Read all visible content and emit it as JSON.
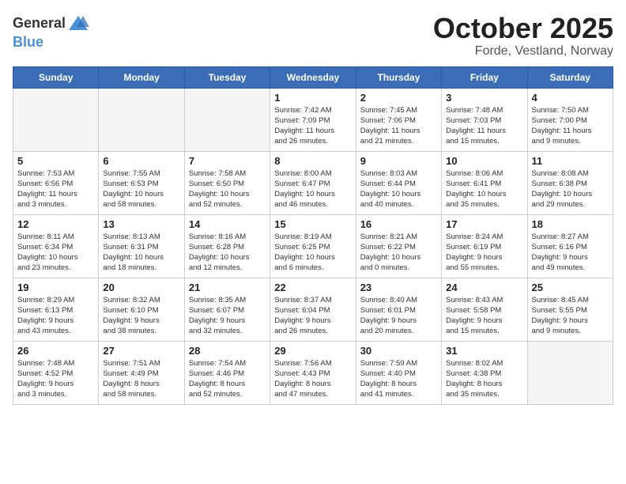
{
  "logo": {
    "general": "General",
    "blue": "Blue"
  },
  "title": "October 2025",
  "location": "Forde, Vestland, Norway",
  "days_of_week": [
    "Sunday",
    "Monday",
    "Tuesday",
    "Wednesday",
    "Thursday",
    "Friday",
    "Saturday"
  ],
  "weeks": [
    [
      {
        "day": "",
        "info": ""
      },
      {
        "day": "",
        "info": ""
      },
      {
        "day": "",
        "info": ""
      },
      {
        "day": "1",
        "info": "Sunrise: 7:42 AM\nSunset: 7:09 PM\nDaylight: 11 hours\nand 26 minutes."
      },
      {
        "day": "2",
        "info": "Sunrise: 7:45 AM\nSunset: 7:06 PM\nDaylight: 11 hours\nand 21 minutes."
      },
      {
        "day": "3",
        "info": "Sunrise: 7:48 AM\nSunset: 7:03 PM\nDaylight: 11 hours\nand 15 minutes."
      },
      {
        "day": "4",
        "info": "Sunrise: 7:50 AM\nSunset: 7:00 PM\nDaylight: 11 hours\nand 9 minutes."
      }
    ],
    [
      {
        "day": "5",
        "info": "Sunrise: 7:53 AM\nSunset: 6:56 PM\nDaylight: 11 hours\nand 3 minutes."
      },
      {
        "day": "6",
        "info": "Sunrise: 7:55 AM\nSunset: 6:53 PM\nDaylight: 10 hours\nand 58 minutes."
      },
      {
        "day": "7",
        "info": "Sunrise: 7:58 AM\nSunset: 6:50 PM\nDaylight: 10 hours\nand 52 minutes."
      },
      {
        "day": "8",
        "info": "Sunrise: 8:00 AM\nSunset: 6:47 PM\nDaylight: 10 hours\nand 46 minutes."
      },
      {
        "day": "9",
        "info": "Sunrise: 8:03 AM\nSunset: 6:44 PM\nDaylight: 10 hours\nand 40 minutes."
      },
      {
        "day": "10",
        "info": "Sunrise: 8:06 AM\nSunset: 6:41 PM\nDaylight: 10 hours\nand 35 minutes."
      },
      {
        "day": "11",
        "info": "Sunrise: 8:08 AM\nSunset: 6:38 PM\nDaylight: 10 hours\nand 29 minutes."
      }
    ],
    [
      {
        "day": "12",
        "info": "Sunrise: 8:11 AM\nSunset: 6:34 PM\nDaylight: 10 hours\nand 23 minutes."
      },
      {
        "day": "13",
        "info": "Sunrise: 8:13 AM\nSunset: 6:31 PM\nDaylight: 10 hours\nand 18 minutes."
      },
      {
        "day": "14",
        "info": "Sunrise: 8:16 AM\nSunset: 6:28 PM\nDaylight: 10 hours\nand 12 minutes."
      },
      {
        "day": "15",
        "info": "Sunrise: 8:19 AM\nSunset: 6:25 PM\nDaylight: 10 hours\nand 6 minutes."
      },
      {
        "day": "16",
        "info": "Sunrise: 8:21 AM\nSunset: 6:22 PM\nDaylight: 10 hours\nand 0 minutes."
      },
      {
        "day": "17",
        "info": "Sunrise: 8:24 AM\nSunset: 6:19 PM\nDaylight: 9 hours\nand 55 minutes."
      },
      {
        "day": "18",
        "info": "Sunrise: 8:27 AM\nSunset: 6:16 PM\nDaylight: 9 hours\nand 49 minutes."
      }
    ],
    [
      {
        "day": "19",
        "info": "Sunrise: 8:29 AM\nSunset: 6:13 PM\nDaylight: 9 hours\nand 43 minutes."
      },
      {
        "day": "20",
        "info": "Sunrise: 8:32 AM\nSunset: 6:10 PM\nDaylight: 9 hours\nand 38 minutes."
      },
      {
        "day": "21",
        "info": "Sunrise: 8:35 AM\nSunset: 6:07 PM\nDaylight: 9 hours\nand 32 minutes."
      },
      {
        "day": "22",
        "info": "Sunrise: 8:37 AM\nSunset: 6:04 PM\nDaylight: 9 hours\nand 26 minutes."
      },
      {
        "day": "23",
        "info": "Sunrise: 8:40 AM\nSunset: 6:01 PM\nDaylight: 9 hours\nand 20 minutes."
      },
      {
        "day": "24",
        "info": "Sunrise: 8:43 AM\nSunset: 5:58 PM\nDaylight: 9 hours\nand 15 minutes."
      },
      {
        "day": "25",
        "info": "Sunrise: 8:45 AM\nSunset: 5:55 PM\nDaylight: 9 hours\nand 9 minutes."
      }
    ],
    [
      {
        "day": "26",
        "info": "Sunrise: 7:48 AM\nSunset: 4:52 PM\nDaylight: 9 hours\nand 3 minutes."
      },
      {
        "day": "27",
        "info": "Sunrise: 7:51 AM\nSunset: 4:49 PM\nDaylight: 8 hours\nand 58 minutes."
      },
      {
        "day": "28",
        "info": "Sunrise: 7:54 AM\nSunset: 4:46 PM\nDaylight: 8 hours\nand 52 minutes."
      },
      {
        "day": "29",
        "info": "Sunrise: 7:56 AM\nSunset: 4:43 PM\nDaylight: 8 hours\nand 47 minutes."
      },
      {
        "day": "30",
        "info": "Sunrise: 7:59 AM\nSunset: 4:40 PM\nDaylight: 8 hours\nand 41 minutes."
      },
      {
        "day": "31",
        "info": "Sunrise: 8:02 AM\nSunset: 4:38 PM\nDaylight: 8 hours\nand 35 minutes."
      },
      {
        "day": "",
        "info": ""
      }
    ]
  ]
}
